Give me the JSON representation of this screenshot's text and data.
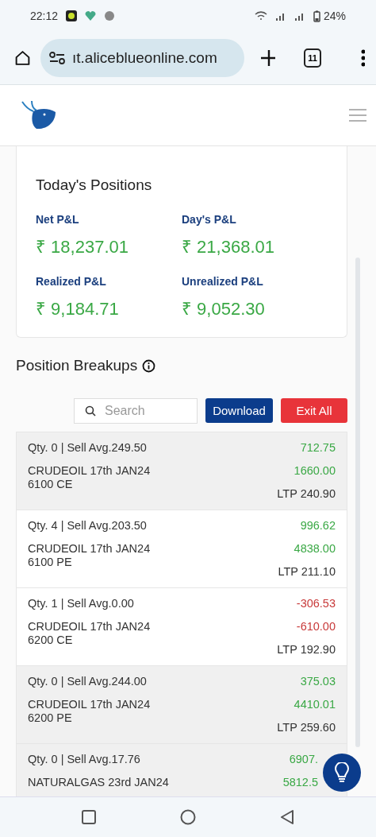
{
  "status_bar": {
    "time": "22:12",
    "battery": "24%"
  },
  "browser": {
    "url": "ıt.aliceblueonline.com",
    "tab_count": "11"
  },
  "summary": {
    "title": "Today's Positions",
    "metrics": [
      {
        "label": "Net P&L",
        "value": "₹ 18,237.01"
      },
      {
        "label": "Day's P&L",
        "value": "₹ 21,368.01"
      },
      {
        "label": "Realized P&L",
        "value": "₹ 9,184.71"
      },
      {
        "label": "Unrealized P&L",
        "value": "₹ 9,052.30"
      }
    ]
  },
  "breakups": {
    "title": "Position Breakups",
    "search": {
      "placeholder": "Search"
    },
    "buttons": [
      {
        "kind": "primary",
        "label": "Download"
      },
      {
        "kind": "danger",
        "label": "Exit All"
      }
    ],
    "rows": [
      {
        "shaded": true,
        "loss": false,
        "qty": "Qty. 0 | Sell Avg.249.50",
        "name": [
          "CRUDEOIL 17th JAN24",
          "6100 CE"
        ],
        "pnl": "712.75",
        "value": "1660.00",
        "ltp": "LTP 240.90"
      },
      {
        "shaded": false,
        "loss": false,
        "qty": "Qty. 4 | Sell Avg.203.50",
        "name": [
          "CRUDEOIL 17th JAN24",
          "6100 PE"
        ],
        "pnl": "996.62",
        "value": "4838.00",
        "ltp": "LTP 211.10"
      },
      {
        "shaded": false,
        "loss": true,
        "qty": "Qty. 1 | Sell Avg.0.00",
        "name": [
          "CRUDEOIL 17th JAN24",
          "6200 CE"
        ],
        "pnl": "-306.53",
        "value": "-610.00",
        "ltp": "LTP 192.90"
      },
      {
        "shaded": true,
        "loss": false,
        "qty": "Qty. 0 | Sell Avg.244.00",
        "name": [
          "CRUDEOIL 17th JAN24",
          "6200 PE"
        ],
        "pnl": "375.03",
        "value": "4410.01",
        "ltp": "LTP 259.60"
      },
      {
        "shaded": true,
        "loss": false,
        "qty": "Qty. 0 | Sell Avg.17.76",
        "name": [
          "NATURALGAS 23rd JAN24"
        ],
        "pnl": "6907.",
        "value": "5812.5"
      }
    ]
  }
}
